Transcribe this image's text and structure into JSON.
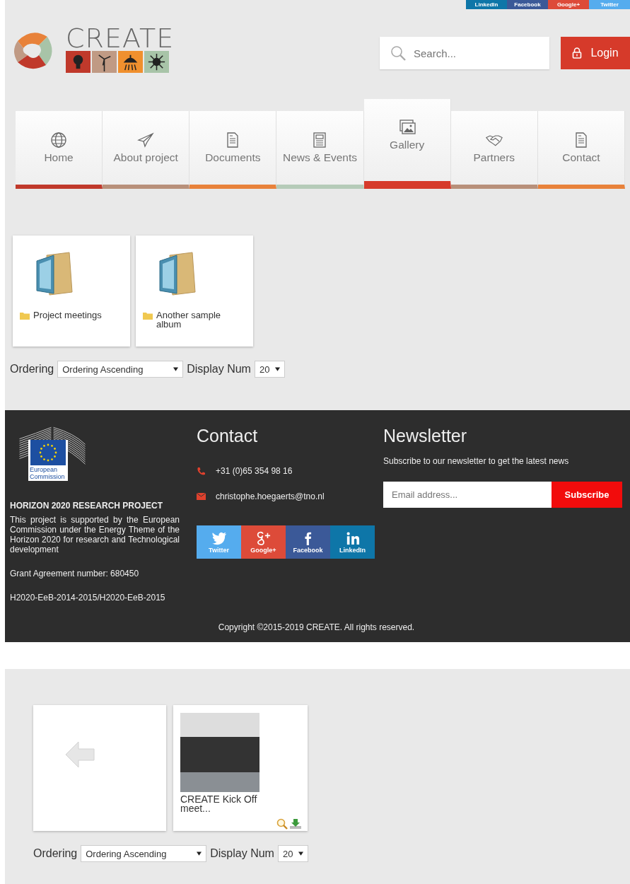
{
  "social_bar": [
    {
      "label": "LinkedIn",
      "color": "#0e76a8"
    },
    {
      "label": "Facebook",
      "color": "#3b5998"
    },
    {
      "label": "Google+",
      "color": "#dd4b39"
    },
    {
      "label": "Twitter",
      "color": "#55acee"
    }
  ],
  "logo": {
    "text": "CREATE"
  },
  "search": {
    "placeholder": "Search..."
  },
  "login": {
    "label": "Login"
  },
  "nav": [
    {
      "label": "Home",
      "kind": "globe",
      "color": "#c0392b",
      "selected": false
    },
    {
      "label": "About project",
      "kind": "plane",
      "color": "#b8907a",
      "selected": false
    },
    {
      "label": "Documents",
      "kind": "doc",
      "color": "#e8823a",
      "selected": false
    },
    {
      "label": "News & Events",
      "kind": "news",
      "color": "#b5cbb8",
      "selected": false
    },
    {
      "label": "Gallery",
      "kind": "image",
      "color": "#d63a2a",
      "selected": true
    },
    {
      "label": "Partners",
      "kind": "hands",
      "color": "#b8907a",
      "selected": false
    },
    {
      "label": "Contact",
      "kind": "doc",
      "color": "#e8823a",
      "selected": false
    }
  ],
  "albums": [
    {
      "title": "Project meetings"
    },
    {
      "title": "Another sample album"
    }
  ],
  "ordering": {
    "label": "Ordering",
    "value": "Ordering Ascending",
    "display_label": "Display Num",
    "display_value": "20"
  },
  "footer": {
    "ec_label": "European Commission",
    "project_title": "HORIZON 2020 RESEARCH PROJECT",
    "project_text": "This project is supported by the European Commission under the Energy Theme of the Horizon 2020 for research and Technological development",
    "grant": "Grant Agreement number: 680450",
    "call": "H2020-EeB-2014-2015/H2020-EeB-2015",
    "contact_title": "Contact",
    "phone": "+31 (0)65 354 98 16",
    "email": "christophe.hoegaerts@tno.nl",
    "social": [
      {
        "label": "Twitter",
        "kind": "twitter",
        "color": "#55acee"
      },
      {
        "label": "Google+",
        "kind": "gplus",
        "color": "#dd4b39"
      },
      {
        "label": "Facebook",
        "kind": "facebook",
        "color": "#3b5998"
      },
      {
        "label": "LinkedIn",
        "kind": "linkedin",
        "color": "#0e76a8"
      }
    ],
    "newsletter_title": "Newsletter",
    "newsletter_text": "Subscribe to our newsletter to get the latest news",
    "email_placeholder": "Email address...",
    "subscribe": "Subscribe",
    "copyright": "Copyright ©2015-2019 CREATE. All rights reserved."
  },
  "album_view": {
    "photos": [
      {
        "caption": "CREATE Kick Off meet..."
      }
    ],
    "ordering": {
      "label": "Ordering",
      "value": "Ordering Ascending",
      "display_label": "Display Num",
      "display_value": "20"
    }
  }
}
